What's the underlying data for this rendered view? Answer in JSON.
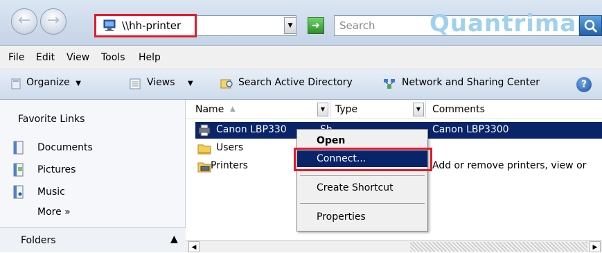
{
  "address_bar": {
    "path": "\\\\hh-printer",
    "search_placeholder": "Search",
    "watermark": "Quantrimang"
  },
  "menu_bar": {
    "items": [
      "File",
      "Edit",
      "View",
      "Tools",
      "Help"
    ]
  },
  "command_bar": {
    "organize": "Organize",
    "views": "Views",
    "search_ad": "Search Active Directory",
    "network": "Network and Sharing Center",
    "help": "?"
  },
  "nav_pane": {
    "favorites_title": "Favorite Links",
    "links": [
      "Documents",
      "Pictures",
      "Music"
    ],
    "more": "More  »",
    "folders": "Folders"
  },
  "file_list": {
    "columns": [
      "Name",
      "Type",
      "Comments"
    ],
    "rows": [
      {
        "name": "Canon LBP330",
        "type": "Sh",
        "comment": "Canon LBP3300"
      },
      {
        "name": "Users",
        "type": "",
        "comment": ""
      },
      {
        "name": "Printers",
        "type": "",
        "comment": "Add or remove printers, view or"
      }
    ]
  },
  "context_menu": {
    "items": [
      "Open",
      "Connect...",
      "Create Shortcut",
      "Properties"
    ]
  },
  "colors": {
    "highlight_border": "#e21b2a",
    "selection": "#0a246a"
  }
}
